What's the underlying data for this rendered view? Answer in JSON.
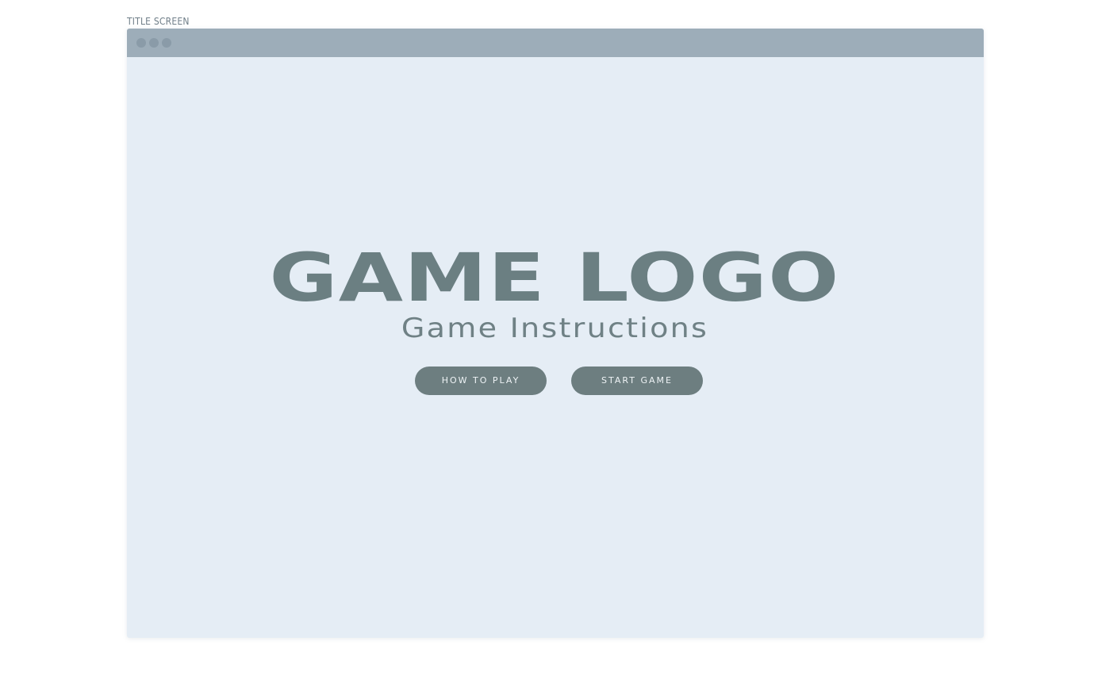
{
  "frame_label": "TITLE SCREEN",
  "window": {
    "controls": [
      "window-dot",
      "window-dot",
      "window-dot"
    ]
  },
  "title_screen": {
    "logo": "GAME LOGO",
    "subtitle": "Game Instructions",
    "buttons": {
      "how_to_play": "HOW TO PLAY",
      "start_game": "START GAME"
    }
  },
  "colors": {
    "page_bg": "#ffffff",
    "screen_bg": "#e5edf5",
    "titlebar_bg": "#9dadb9",
    "accent": "#6d7e80"
  }
}
